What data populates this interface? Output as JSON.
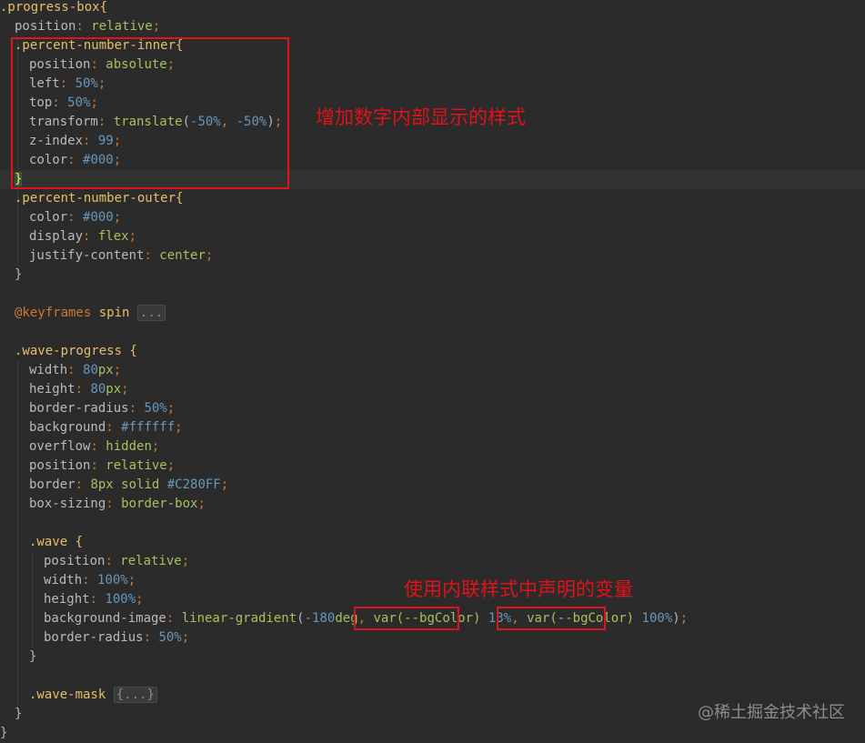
{
  "code": {
    "l1_sel": ".progress-box{",
    "l2_prop": "position",
    "l2_val": "relative",
    "l3_sel": ".percent-number-inner{",
    "l4_prop": "position",
    "l4_val": "absolute",
    "l5_prop": "left",
    "l5_val": "50%",
    "l6_prop": "top",
    "l6_val": "50%",
    "l7_prop": "transform",
    "l7_fn": "translate",
    "l7_a": "-50%",
    "l7_b": "-50%",
    "l8_prop": "z-index",
    "l8_val": "99",
    "l9_prop": "color",
    "l9_val": "#000",
    "l10": "}",
    "l11_sel": ".percent-number-outer{",
    "l12_prop": "color",
    "l12_val": "#000",
    "l13_prop": "display",
    "l13_val": "flex",
    "l14_prop": "justify-content",
    "l14_val": "center",
    "l15": "}",
    "l17_at": "@keyframes",
    "l17_name": "spin",
    "l17_fold": "...",
    "l19_sel": ".wave-progress {",
    "l20_prop": "width",
    "l20_val": "80",
    "l20_unit": "px",
    "l21_prop": "height",
    "l21_val": "80",
    "l21_unit": "px",
    "l22_prop": "border-radius",
    "l22_val": "50%",
    "l23_prop": "background",
    "l23_val": "#ffffff",
    "l24_prop": "overflow",
    "l24_val": "hidden",
    "l25_prop": "position",
    "l25_val": "relative",
    "l26_prop": "border",
    "l26_val": "8px solid",
    "l26_color": "#C280FF",
    "l27_prop": "box-sizing",
    "l27_val": "border-box",
    "l29_sel": ".wave {",
    "l30_prop": "position",
    "l30_val": "relative",
    "l31_prop": "width",
    "l31_val": "100%",
    "l32_prop": "height",
    "l32_val": "100%",
    "l33_prop": "background-image",
    "l33_fn": "linear-gradient",
    "l33_deg": "-180",
    "l33_deg_unit": "deg",
    "l33_var1": "var(--bgColor)",
    "l33_p1": "13%",
    "l33_var2": "var(--bgColor)",
    "l33_p2": "100%",
    "l34_prop": "border-radius",
    "l34_val": "50%",
    "l35": "}",
    "l37_sel": ".wave-mask",
    "l37_fold": "{...}",
    "l38": "}",
    "l39": "}"
  },
  "annotations": {
    "note1": "增加数字内部显示的样式",
    "note2": "使用内联样式中声明的变量"
  },
  "watermark": "@稀土掘金技术社区",
  "colors": {
    "annotation": "#e0121a",
    "background": "#2b2b2b"
  }
}
